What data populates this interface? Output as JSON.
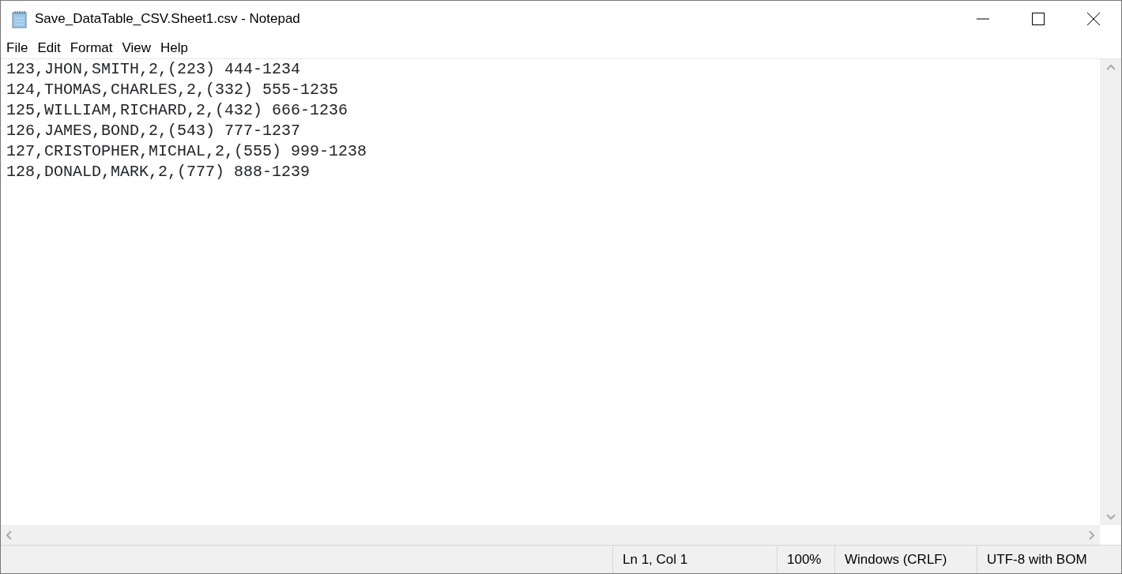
{
  "window": {
    "title": "Save_DataTable_CSV.Sheet1.csv - Notepad"
  },
  "menu": [
    {
      "label": "File"
    },
    {
      "label": "Edit"
    },
    {
      "label": "Format"
    },
    {
      "label": "View"
    },
    {
      "label": "Help"
    }
  ],
  "editor": {
    "lines": [
      "123,JHON,SMITH,2,(223) 444-1234",
      "124,THOMAS,CHARLES,2,(332) 555-1235",
      "125,WILLIAM,RICHARD,2,(432) 666-1236",
      "126,JAMES,BOND,2,(543) 777-1237",
      "127,CRISTOPHER,MICHAL,2,(555) 999-1238",
      "128,DONALD,MARK,2,(777) 888-1239"
    ]
  },
  "status_bar": [
    "Ln 1, Col 1",
    "100%",
    "Windows (CRLF)",
    "UTF-8 with BOM"
  ]
}
